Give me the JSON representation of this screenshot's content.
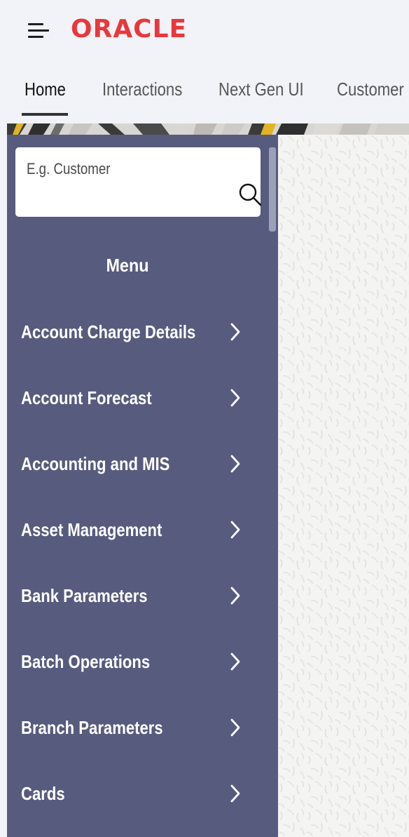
{
  "header": {
    "logo_text": "ORACLE",
    "logo_color": "#e8383b",
    "menu_icon": "hamburger-icon",
    "tabs": [
      {
        "label": "Home",
        "active": true
      },
      {
        "label": "Interactions",
        "active": false
      },
      {
        "label": "Next Gen UI",
        "active": false
      },
      {
        "label": "Customer",
        "active": false
      }
    ]
  },
  "sidebar": {
    "background_color": "#575b7e",
    "search": {
      "placeholder": "E.g. Customer",
      "value": "",
      "icon": "search-icon"
    },
    "menu_title": "Menu",
    "items": [
      {
        "label": "Account Charge Details",
        "icon": "chevron-right-icon"
      },
      {
        "label": "Account Forecast",
        "icon": "chevron-right-icon"
      },
      {
        "label": "Accounting and MIS",
        "icon": "chevron-right-icon"
      },
      {
        "label": "Asset Management",
        "icon": "chevron-right-icon"
      },
      {
        "label": "Bank Parameters",
        "icon": "chevron-right-icon"
      },
      {
        "label": "Batch Operations",
        "icon": "chevron-right-icon"
      },
      {
        "label": "Branch Parameters",
        "icon": "chevron-right-icon"
      },
      {
        "label": "Cards",
        "icon": "chevron-right-icon"
      }
    ]
  }
}
